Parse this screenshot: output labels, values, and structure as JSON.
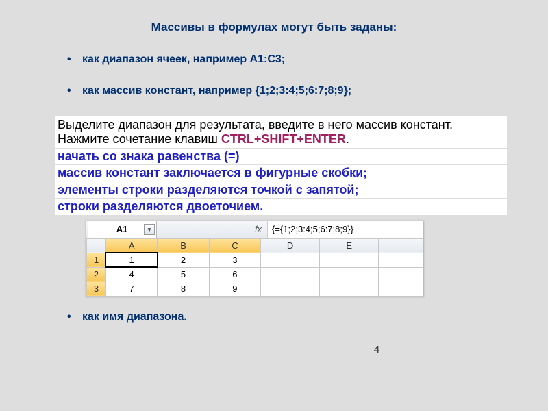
{
  "title": "Массивы в формулах могут быть заданы:",
  "bullets": {
    "b1": "как диапазон ячеек, например А1:С3;",
    "b2": "как массив констант, например {1;2;3:4;5;6:7;8;9};",
    "b3": "как имя диапазона."
  },
  "instruction": {
    "line1": "Выделите диапазон для результата,  введите в него массив констант.",
    "line2a": "Нажмите сочетание клавиш ",
    "hotkeys": "CTRL+SHIFT+ENTER",
    "line2b": ".",
    "blue1": "начать со знака равенства (=)",
    "blue2": "массив констант заключается в фигурные скобки;",
    "blue3": "элементы строки разделяются точкой с запятой;",
    "blue4": "строки разделяются двоеточием."
  },
  "sheet": {
    "namebox": "A1",
    "fx_label": "fx",
    "formula": "{={1;2;3:4;5;6:7;8;9}}",
    "cols": [
      "A",
      "B",
      "C",
      "D",
      "E"
    ],
    "rows": [
      "1",
      "2",
      "3"
    ]
  },
  "chart_data": {
    "type": "table",
    "title": "Array constant entered via CTRL+SHIFT+ENTER",
    "columns": [
      "A",
      "B",
      "C"
    ],
    "rows": [
      "1",
      "2",
      "3"
    ],
    "values": [
      [
        1,
        2,
        3
      ],
      [
        4,
        5,
        6
      ],
      [
        7,
        8,
        9
      ]
    ]
  },
  "page_number": "4"
}
